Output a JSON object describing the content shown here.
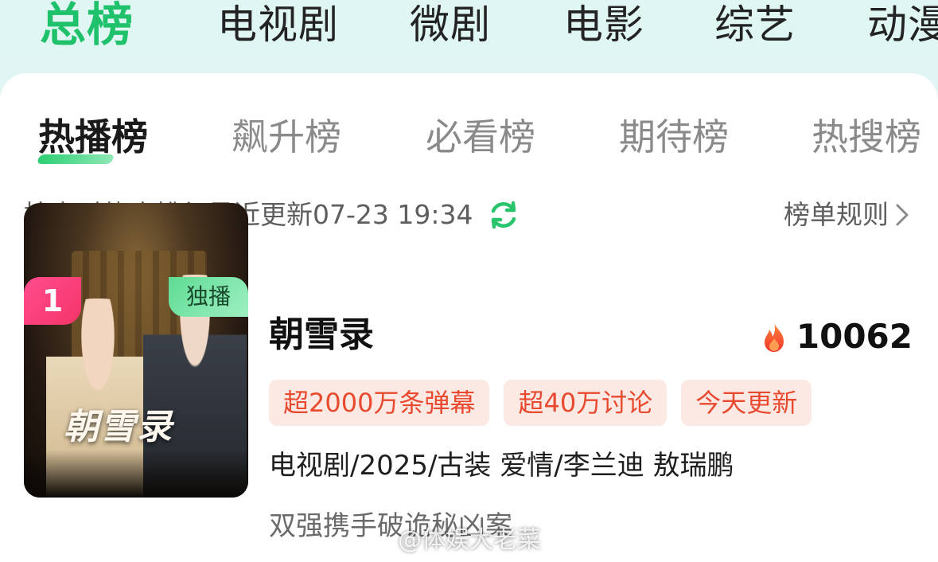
{
  "top_tabs": [
    {
      "label": "总榜",
      "active": true
    },
    {
      "label": "电视剧",
      "active": false
    },
    {
      "label": "微剧",
      "active": false
    },
    {
      "label": "电影",
      "active": false
    },
    {
      "label": "综艺",
      "active": false
    },
    {
      "label": "动漫",
      "active": false
    }
  ],
  "sub_tabs": [
    {
      "label": "热播榜",
      "active": true
    },
    {
      "label": "飙升榜",
      "active": false
    },
    {
      "label": "必看榜",
      "active": false
    },
    {
      "label": "期待榜",
      "active": false
    },
    {
      "label": "热搜榜",
      "active": false
    }
  ],
  "info": {
    "ranking_note": "按实时热度排行最近更新07-23 19:34",
    "rules_label": "榜单规则"
  },
  "item": {
    "rank": "1",
    "badge": "独播",
    "poster_title": "朝雪录",
    "title": "朝雪录",
    "heat": "10062",
    "tags": [
      "超2000万条弹幕",
      "超40万讨论",
      "今天更新"
    ],
    "meta": "电视剧/2025/古装 爱情/李兰迪 敖瑞鹏",
    "description": "双强携手破诡秘凶案"
  },
  "watermark": "@体娱大老菜",
  "colors": {
    "accent_green": "#1fc16b",
    "rank_pink": "#f5346a",
    "tag_bg": "#fde9e4",
    "tag_text": "#e84a2f",
    "flame": "#ff5a2a"
  },
  "icons": [
    "refresh-icon",
    "chevron-right-icon",
    "flame-icon"
  ]
}
